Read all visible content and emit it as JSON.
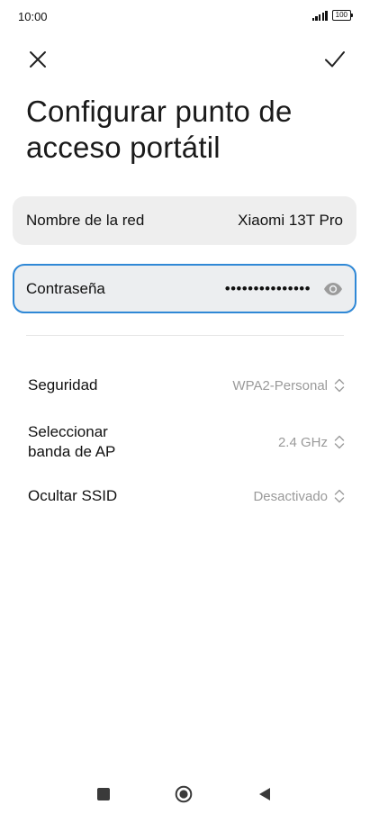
{
  "status_bar": {
    "time": "10:00",
    "battery": "100",
    "signal_icon": "signal-bars-icon",
    "battery_icon": "battery-icon"
  },
  "header": {
    "close_icon": "close-icon",
    "confirm_icon": "checkmark-icon",
    "title": "Configurar punto de acceso portátil"
  },
  "fields": {
    "network_name": {
      "label": "Nombre de la red",
      "value": "Xiaomi 13T Pro"
    },
    "password": {
      "label": "Contraseña",
      "value": "•••••••••••••••",
      "toggle_icon": "eye-icon",
      "focus_color": "#2f88d6"
    }
  },
  "settings": {
    "security": {
      "label": "Seguridad",
      "value": "WPA2-Personal"
    },
    "band": {
      "label": "Seleccionar banda de AP",
      "value": "2.4 GHz"
    },
    "hide_ssid": {
      "label": "Ocultar SSID",
      "value": "Desactivado"
    },
    "selector_icon": "up-down-chevron-icon"
  },
  "nav_bar": {
    "recents_icon": "recents-square-icon",
    "home_icon": "home-circle-icon",
    "back_icon": "back-triangle-icon"
  },
  "colors": {
    "accent": "#2f88d6",
    "card_background": "#eeeeee",
    "secondary_text": "#9a9a9a"
  }
}
